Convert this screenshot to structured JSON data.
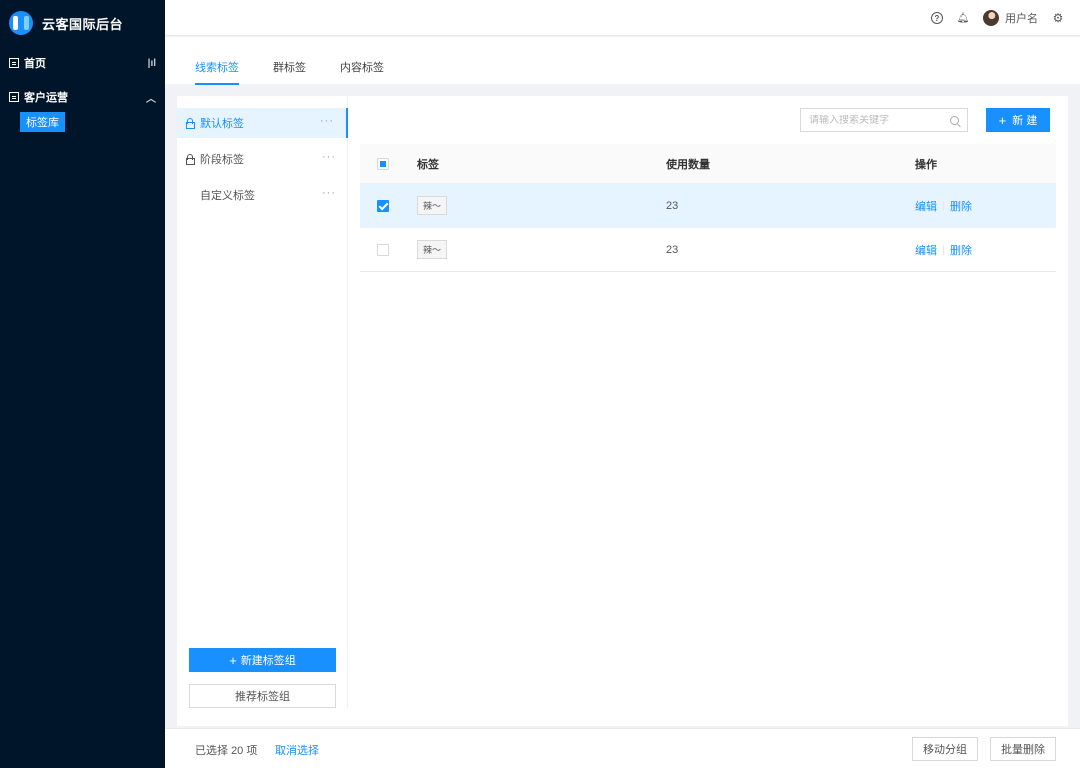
{
  "app": {
    "title": "云客国际后台"
  },
  "sidebar": {
    "items": [
      {
        "label": "首页"
      },
      {
        "label": "客户运营",
        "children": [
          {
            "label": "标签库",
            "active": true
          }
        ]
      }
    ]
  },
  "header": {
    "username": "用户名",
    "icons": [
      "help-icon",
      "bell-icon",
      "avatar",
      "settings-icon"
    ]
  },
  "tabs": [
    {
      "label": "线索标签",
      "active": true
    },
    {
      "label": "群标签",
      "active": false
    },
    {
      "label": "内容标签",
      "active": false
    }
  ],
  "groups": {
    "items": [
      {
        "label": "默认标签",
        "locked": true,
        "active": true
      },
      {
        "label": "阶段标签",
        "locked": true,
        "active": false
      },
      {
        "label": "自定义标签",
        "locked": false,
        "active": false
      }
    ],
    "more_glyph": "···",
    "new_group_label": "新建标签组",
    "recommend_group_label": "推荐标签组"
  },
  "search": {
    "placeholder": "请输入搜索关键字",
    "value": ""
  },
  "new_button": {
    "label": "新 建"
  },
  "table": {
    "columns": [
      "标签",
      "使用数量",
      "操作"
    ],
    "rows": [
      {
        "tag": "辣～",
        "count": "23",
        "selected": true,
        "edit": "编辑",
        "delete": "删除"
      },
      {
        "tag": "辣～",
        "count": "23",
        "selected": false,
        "edit": "编辑",
        "delete": "删除"
      }
    ]
  },
  "footer": {
    "selected_text": "已选择 20 项",
    "cancel_label": "取消选择",
    "move_label": "移动分组",
    "batch_delete_label": "批量删除"
  },
  "colors": {
    "sidebar_bg": "#001529",
    "primary": "#1890ff",
    "selected_row": "#e6f4ff"
  }
}
